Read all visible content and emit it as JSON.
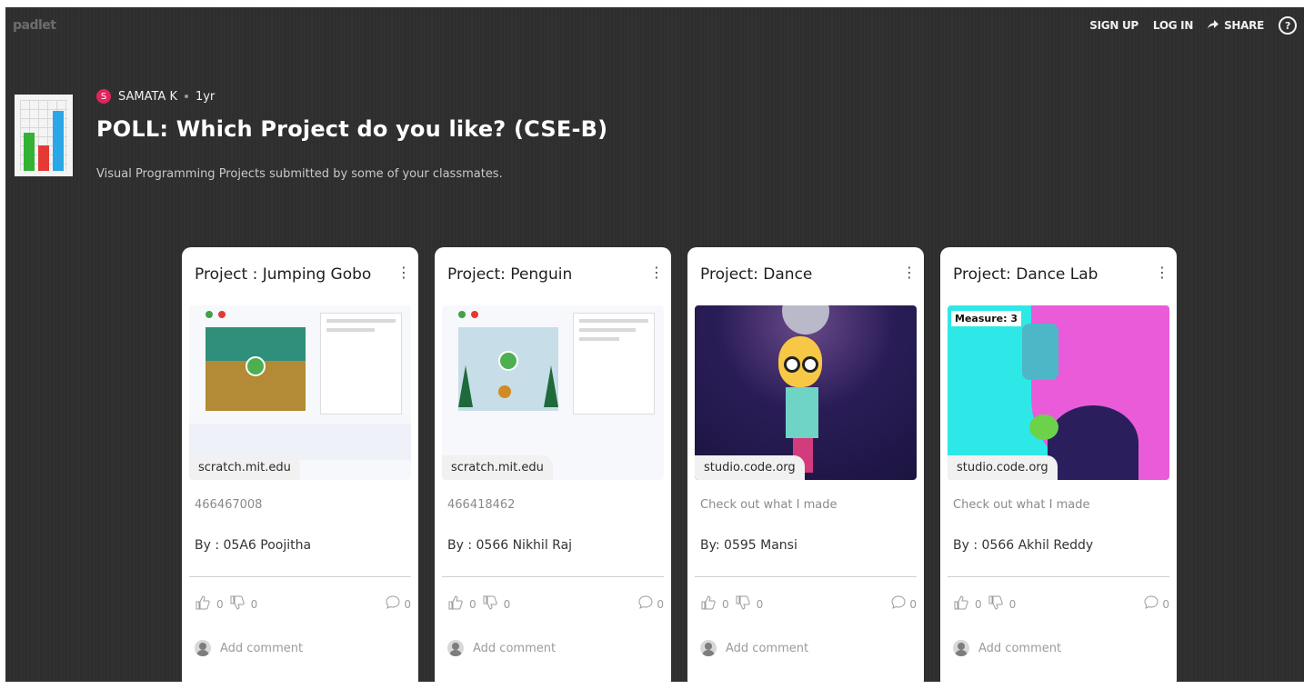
{
  "topbar": {
    "brand": "padlet",
    "signup": "SIGN UP",
    "login": "LOG IN",
    "share": "SHARE",
    "help": "?"
  },
  "header": {
    "author_initial": "S",
    "author": "SAMATA K",
    "age": "1yr",
    "title": "POLL: Which Project do you like? (CSE-B)",
    "subtitle": "Visual Programming Projects submitted by some of your classmates."
  },
  "cards": [
    {
      "title": "Project : Jumping Gobo",
      "domain": "scratch.mit.edu",
      "description": "466467008",
      "by": "By : 05A6 Poojitha",
      "likes": "0",
      "dislikes": "0",
      "comments": "0",
      "add_comment": "Add comment"
    },
    {
      "title": "Project: Penguin",
      "domain": "scratch.mit.edu",
      "description": "466418462",
      "by": "By : 0566 Nikhil Raj",
      "likes": "0",
      "dislikes": "0",
      "comments": "0",
      "add_comment": "Add comment"
    },
    {
      "title": "Project: Dance",
      "domain": "studio.code.org",
      "description": "Check out what I made",
      "by": "By: 0595 Mansi",
      "likes": "0",
      "dislikes": "0",
      "comments": "0",
      "add_comment": "Add comment"
    },
    {
      "title": "Project: Dance Lab",
      "domain": "studio.code.org",
      "description": "Check out what I made",
      "by": "By : 0566 Akhil Reddy",
      "likes": "0",
      "dislikes": "0",
      "comments": "0",
      "add_comment": "Add comment",
      "preview_label": "Measure: 3"
    }
  ],
  "colors": {
    "background": "#2f2f2f",
    "card": "#ffffff",
    "avatar": "#e0245e"
  },
  "icons": [
    "share-icon",
    "help-icon",
    "thumbs-up-icon",
    "thumbs-down-icon",
    "comment-icon",
    "kebab-icon",
    "avatar-icon"
  ]
}
